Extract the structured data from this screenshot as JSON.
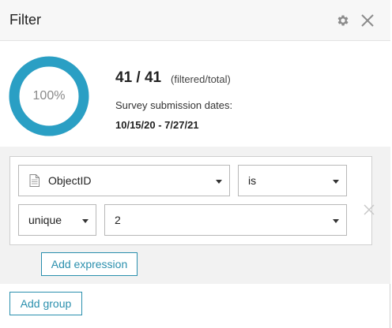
{
  "header": {
    "title": "Filter"
  },
  "summary": {
    "percent": "100%",
    "percent_value": 1.0,
    "count": "41 / 41",
    "count_note": "(filtered/total)",
    "dates_label": "Survey submission dates:",
    "dates_value": "10/15/20 - 7/27/21"
  },
  "expression": {
    "field": "ObjectID",
    "operator": "is",
    "mode": "unique",
    "value": "2"
  },
  "buttons": {
    "add_expression": "Add expression",
    "add_group": "Add group"
  },
  "colors": {
    "accent": "#2a8fad",
    "donut_ring": "#2a9fc4"
  },
  "icons": [
    "gear-icon",
    "close-icon",
    "document-icon",
    "remove-expression-icon",
    "dropdown-caret-icon"
  ]
}
